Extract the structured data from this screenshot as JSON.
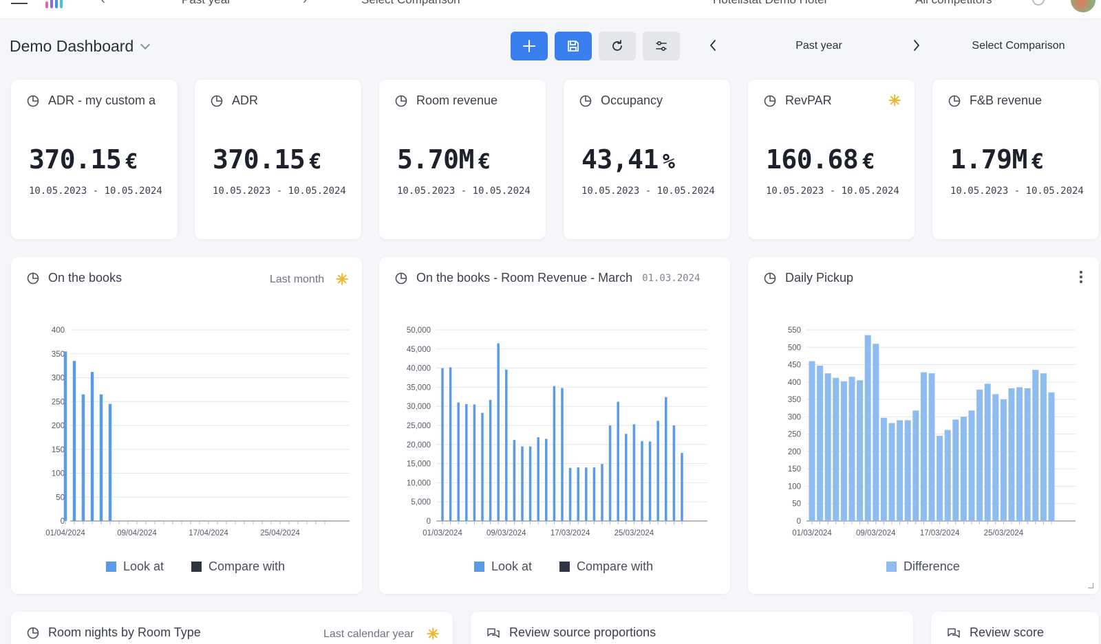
{
  "topnav": {
    "period": "Past year",
    "compare": "Select Comparison",
    "hotel": "Hotelistat Demo Hotel",
    "competitors": "All competitors"
  },
  "toolbar": {
    "dashboard_title": "Demo Dashboard",
    "period_label": "Past year",
    "select_comparison": "Select Comparison"
  },
  "kpis": [
    {
      "title": "ADR  - my custom a",
      "value": "370.15",
      "unit": "€",
      "dates": "10.05.2023 - 10.05.2024",
      "starred": false
    },
    {
      "title": "ADR",
      "value": "370.15",
      "unit": "€",
      "dates": "10.05.2023 - 10.05.2024",
      "starred": false
    },
    {
      "title": "Room revenue",
      "value": "5.70M",
      "unit": "€",
      "dates": "10.05.2023 - 10.05.2024",
      "starred": false
    },
    {
      "title": "Occupancy",
      "value": "43,41",
      "unit": "%",
      "dates": "10.05.2023 - 10.05.2024",
      "starred": false
    },
    {
      "title": "RevPAR",
      "value": "160.68",
      "unit": "€",
      "dates": "10.05.2023 - 10.05.2024",
      "starred": true
    },
    {
      "title": "F&B revenue",
      "value": "1.79M",
      "unit": "€",
      "dates": "10.05.2023 - 10.05.2024",
      "starred": false
    }
  ],
  "charts": {
    "otb": {
      "title": "On the books",
      "period": "Last month",
      "legend": [
        "Look at",
        "Compare with"
      ]
    },
    "otb_march": {
      "title": "On the books  - Room Revenue - March",
      "date": "01.03.2024",
      "legend": [
        "Look at",
        "Compare with"
      ]
    },
    "pickup": {
      "title": "Daily Pickup",
      "legend": [
        "Difference"
      ]
    }
  },
  "bottom": {
    "room_nights": {
      "title": "Room nights by Room Type",
      "period": "Last calendar year"
    },
    "review_sources": {
      "title": "Review source proportions"
    },
    "review_score": {
      "title": "Review score"
    }
  },
  "colors": {
    "accent": "#3a7ff0",
    "bar": "#5b9ae6",
    "bar_light": "#8ebcf0",
    "compare": "#2f3542",
    "star": "#f0b429"
  },
  "chart_data": [
    {
      "type": "bar",
      "title": "On the books",
      "x_ticks": [
        "01/04/2024",
        "09/04/2024",
        "17/04/2024",
        "25/04/2024"
      ],
      "x_count": 30,
      "ylim": [
        0,
        400
      ],
      "y_ticks": [
        0,
        50,
        100,
        150,
        200,
        250,
        300,
        350,
        400
      ],
      "series": [
        {
          "name": "Look at",
          "color": "#5b9ae6",
          "values": [
            355,
            335,
            265,
            312,
            265,
            245,
            0,
            0,
            0,
            0,
            0,
            0,
            0,
            0,
            0,
            0,
            0,
            0,
            0,
            0,
            0,
            0,
            0,
            0,
            0,
            0,
            0,
            0,
            0,
            0
          ]
        }
      ],
      "legend": [
        "Look at",
        "Compare with"
      ]
    },
    {
      "type": "bar",
      "title": "On the books  - Room Revenue - March",
      "x_ticks": [
        "01/03/2024",
        "09/03/2024",
        "17/03/2024",
        "25/03/2024"
      ],
      "x_count": 31,
      "ylim": [
        0,
        50000
      ],
      "y_ticks": [
        0,
        5000,
        10000,
        15000,
        20000,
        25000,
        30000,
        35000,
        40000,
        45000,
        50000
      ],
      "y_tick_labels": [
        "0",
        "5,000",
        "10,000",
        "15,000",
        "20,000",
        "25,000",
        "30,000",
        "35,000",
        "40,000",
        "45,000",
        "50,000"
      ],
      "series": [
        {
          "name": "Look at",
          "color": "#5b9ae6",
          "values": [
            40000,
            40200,
            31000,
            30600,
            30500,
            28300,
            31700,
            46500,
            39600,
            21200,
            19500,
            19500,
            21900,
            21500,
            35300,
            34800,
            13900,
            14000,
            14000,
            14000,
            14900,
            25000,
            31200,
            22800,
            25300,
            20900,
            20800,
            26200,
            32400,
            25000,
            17800
          ]
        }
      ],
      "legend": [
        "Look at",
        "Compare with"
      ]
    },
    {
      "type": "bar",
      "title": "Daily Pickup",
      "x_ticks": [
        "01/03/2024",
        "09/03/2024",
        "17/03/2024",
        "25/03/2024"
      ],
      "x_count": 31,
      "ylim": [
        0,
        550
      ],
      "y_ticks": [
        0,
        50,
        100,
        150,
        200,
        250,
        300,
        350,
        400,
        450,
        500,
        550
      ],
      "series": [
        {
          "name": "Difference",
          "color": "#8ebcf0",
          "values": [
            460,
            447,
            425,
            412,
            402,
            415,
            405,
            535,
            510,
            297,
            282,
            290,
            290,
            318,
            428,
            425,
            245,
            262,
            292,
            300,
            318,
            378,
            395,
            365,
            350,
            382,
            385,
            382,
            435,
            425,
            370
          ]
        }
      ],
      "legend": [
        "Difference"
      ]
    }
  ]
}
